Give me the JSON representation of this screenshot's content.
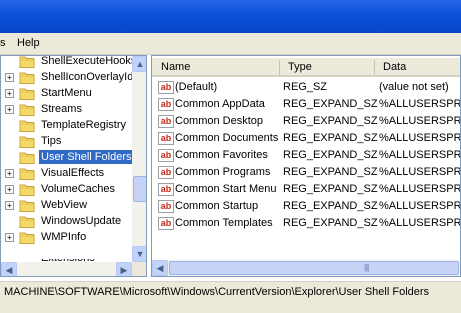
{
  "menu": {
    "help_label": "Help"
  },
  "tree": {
    "items": [
      {
        "label": "ShellExecuteHooks",
        "expandable": false
      },
      {
        "label": "ShellIconOverlayIdentifiers",
        "expandable": true
      },
      {
        "label": "StartMenu",
        "expandable": true
      },
      {
        "label": "Streams",
        "expandable": true
      },
      {
        "label": "TemplateRegistry",
        "expandable": false
      },
      {
        "label": "Tips",
        "expandable": false
      },
      {
        "label": "User Shell Folders",
        "expandable": false,
        "selected": true
      },
      {
        "label": "VisualEffects",
        "expandable": true
      },
      {
        "label": "VolumeCaches",
        "expandable": true
      },
      {
        "label": "WebView",
        "expandable": true
      },
      {
        "label": "WindowsUpdate",
        "expandable": false
      },
      {
        "label": "WMPInfo",
        "expandable": true
      },
      {
        "label": "Extensions",
        "expandable": true
      }
    ]
  },
  "list": {
    "columns": {
      "name": "Name",
      "type": "Type",
      "data": "Data"
    },
    "rows": [
      {
        "name": "(Default)",
        "type": "REG_SZ",
        "data": "(value not set)"
      },
      {
        "name": "Common AppData",
        "type": "REG_EXPAND_SZ",
        "data": "%ALLUSERSPROFILE%"
      },
      {
        "name": "Common Desktop",
        "type": "REG_EXPAND_SZ",
        "data": "%ALLUSERSPROFILE%"
      },
      {
        "name": "Common Documents",
        "type": "REG_EXPAND_SZ",
        "data": "%ALLUSERSPROFILE%"
      },
      {
        "name": "Common Favorites",
        "type": "REG_EXPAND_SZ",
        "data": "%ALLUSERSPROFILE%"
      },
      {
        "name": "Common Programs",
        "type": "REG_EXPAND_SZ",
        "data": "%ALLUSERSPROFILE%"
      },
      {
        "name": "Common Start Menu",
        "type": "REG_EXPAND_SZ",
        "data": "%ALLUSERSPROFILE%"
      },
      {
        "name": "Common Startup",
        "type": "REG_EXPAND_SZ",
        "data": "%ALLUSERSPROFILE%"
      },
      {
        "name": "Common Templates",
        "type": "REG_EXPAND_SZ",
        "data": "%ALLUSERSPROFILE%"
      }
    ],
    "value_icon_text": "ab"
  },
  "status": {
    "path": "MACHINE\\SOFTWARE\\Microsoft\\Windows\\CurrentVersion\\Explorer\\User Shell Folders"
  },
  "colors": {
    "titlebar": "#0b4fd8",
    "selection": "#316ac5",
    "folder": "#f5d96b"
  }
}
